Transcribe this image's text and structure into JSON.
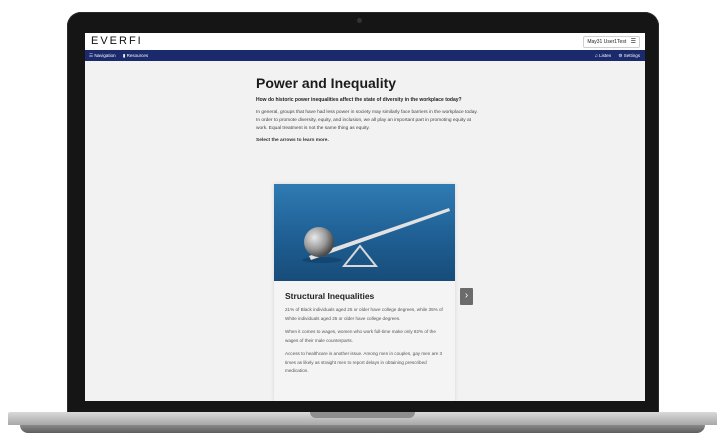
{
  "header": {
    "logo": "EVERFI",
    "user_label": "May31 User1Test",
    "menu_icon": "hamburger-icon"
  },
  "nav": {
    "navigation_label": "Navigation",
    "resources_label": "Resources",
    "listen_label": "Listen",
    "settings_label": "Settings"
  },
  "main": {
    "title": "Power and Inequality",
    "question": "How do historic power inequalities affect the state of diversity in the workplace today?",
    "paragraph": "In general, groups that have had less power in society may similarly face barriers in the workplace today. In order to promote diversity, equity, and inclusion, we all play an important part in promoting equity at work. Equal treatment is not the same thing as equity.",
    "instruction": "Select the arrows to learn more."
  },
  "card": {
    "title": "Structural Inequalities",
    "p1": "21% of Black individuals aged 25 or older have college degrees, while 35% of White individuals aged 25 or older have college degrees.",
    "p2": "When it comes to wages, women who work full-time make only 82% of the wages of their male counterparts.",
    "p3": "Access to healthcare is another issue. Among men in couples, gay men are 3 times as likely as straight men to report delays in obtaining prescribed medication.",
    "next_arrow": "›"
  },
  "colors": {
    "nav_bar": "#1a2a6c",
    "card_image": "#2f7bb3"
  }
}
